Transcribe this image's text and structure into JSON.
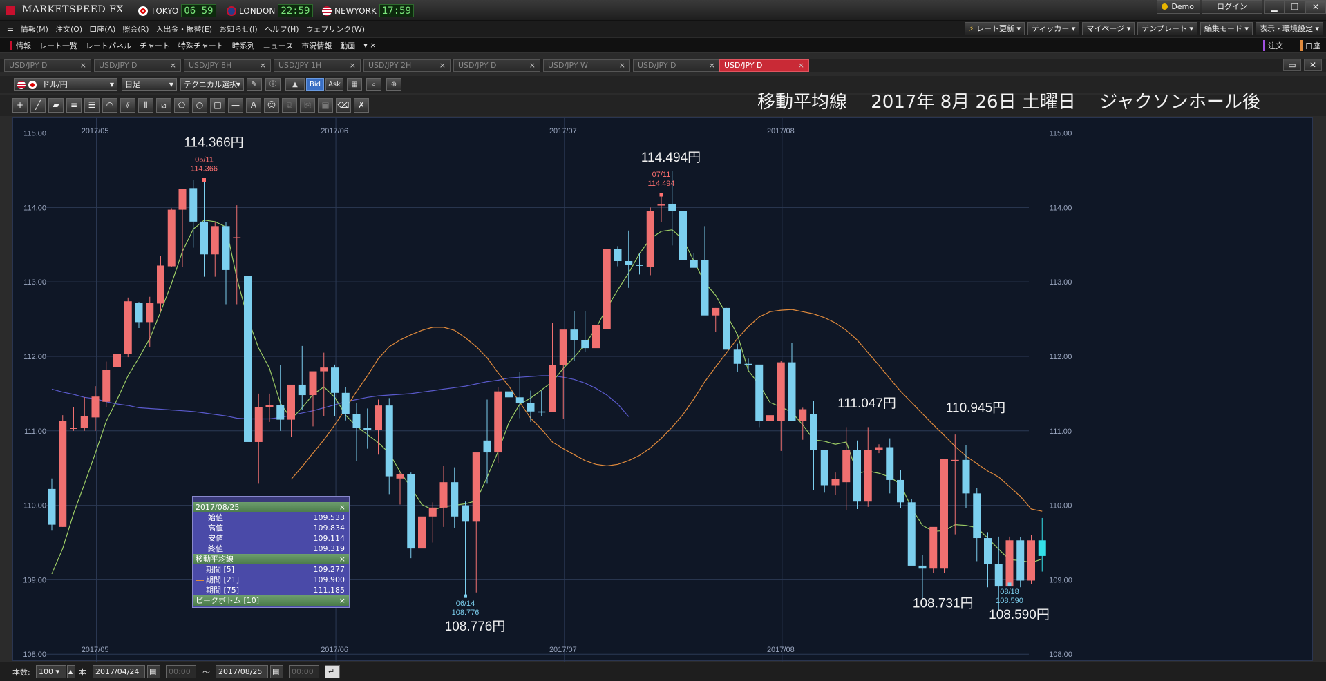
{
  "app": {
    "title": "MARKETSPEED FX",
    "clocks": [
      {
        "city": "TOKYO",
        "time": "06 59",
        "flag": "jp-flag-icon"
      },
      {
        "city": "LONDON",
        "time": "22:59",
        "flag": "uk-flag-icon"
      },
      {
        "city": "NEWYORK",
        "time": "17:59",
        "flag": "us-flag-icon"
      }
    ],
    "demo_label": "Demo",
    "login_label": "ログイン"
  },
  "menu": {
    "items": [
      "情報(M)",
      "注文(O)",
      "口座(A)",
      "照会(R)",
      "入出金・振替(E)",
      "お知らせ(I)",
      "ヘルプ(H)",
      "ウェブリンク(W)"
    ],
    "right_tools": [
      "レート更新",
      "ティッカー",
      "マイページ",
      "テンプレート",
      "編集モード",
      "表示・環境設定"
    ]
  },
  "subbar": {
    "items": [
      "情報",
      "レート一覧",
      "レートパネル",
      "チャート",
      "特殊チャート",
      "時系列",
      "ニュース",
      "市況情報",
      "動画"
    ],
    "order_label": "注文",
    "account_label": "口座"
  },
  "tabs": [
    "USD/JPY D",
    "USD/JPY D",
    "USD/JPY 8H",
    "USD/JPY 1H",
    "USD/JPY 2H",
    "USD/JPY D",
    "USD/JPY W",
    "USD/JPY D",
    "USD/JPY D"
  ],
  "active_tab": 8,
  "toolbar": {
    "pair": "ドル/円",
    "period": "日足",
    "technical": "テクニカル選択",
    "bid": "Bid",
    "ask": "Ask"
  },
  "heading": "移動平均線　 2017年 8月 26日 土曜日　 ジャクソンホール後",
  "popup": {
    "date": "2017/08/25",
    "rows": [
      {
        "label": "始値",
        "value": "109.533"
      },
      {
        "label": "高値",
        "value": "109.834"
      },
      {
        "label": "安値",
        "value": "109.114"
      },
      {
        "label": "終値",
        "value": "109.319"
      }
    ],
    "ma_title": "移動平均線",
    "ma_rows": [
      {
        "label": "期間 [5]",
        "value": "109.277",
        "color": "#9ccc65"
      },
      {
        "label": "期間 [21]",
        "value": "109.900",
        "color": "#e08a3c"
      },
      {
        "label": "期間 [75]",
        "value": "111.185",
        "color": "#5a5acc"
      }
    ],
    "peak_title": "ピークボトム [10]",
    "close_glyph": "×"
  },
  "bottom": {
    "count_label": "本数:",
    "count": "100",
    "unit": "本",
    "from_date": "2017/04/24",
    "from_time": "00:00",
    "tilde": "〜",
    "to_date": "2017/08/25",
    "to_time": "00:00"
  },
  "annotations": [
    {
      "text": "114.366円",
      "i": 14,
      "pos": "above"
    },
    {
      "text": "114.494円",
      "i": 56,
      "pos": "above"
    },
    {
      "text": "108.776円",
      "i": 38,
      "pos": "below"
    },
    {
      "text": "111.047円",
      "i": 74,
      "pos": "above"
    },
    {
      "text": "110.945円",
      "i": 84,
      "pos": "above"
    },
    {
      "text": "108.731円",
      "i": 81,
      "pos": "below"
    },
    {
      "text": "108.590円",
      "i": 88,
      "pos": "below"
    }
  ],
  "peaks": [
    {
      "i": 14,
      "date": "05/11",
      "value": "114.366",
      "type": "high"
    },
    {
      "i": 56,
      "date": "07/11",
      "value": "114.494",
      "type": "high"
    },
    {
      "i": 38,
      "date": "06/14",
      "value": "108.776",
      "type": "low"
    },
    {
      "i": 88,
      "date": "08/18",
      "value": "108.590",
      "type": "low"
    }
  ],
  "chart_data": {
    "type": "candlestick",
    "y_range": [
      107.9,
      115.2
    ],
    "y_ticks": [
      "115.00",
      "114.00",
      "113.00",
      "112.00",
      "111.00",
      "110.00",
      "109.00",
      "108.00"
    ],
    "x_labels": [
      {
        "label": "2017/05",
        "i": 5
      },
      {
        "label": "2017/06",
        "i": 27
      },
      {
        "label": "2017/07",
        "i": 48
      },
      {
        "label": "2017/08",
        "i": 68
      }
    ],
    "colors": {
      "up": "#f07070",
      "down": "#7ccfee",
      "ma5": "#9ccc65",
      "ma21": "#e08a3c",
      "ma75": "#5a5acc",
      "last": "#33e0e8"
    },
    "candles": [
      [
        110.22,
        110.36,
        109.66,
        109.74
      ],
      [
        109.71,
        111.21,
        109.71,
        111.13
      ],
      [
        111.04,
        111.32,
        111.0,
        111.04
      ],
      [
        111.04,
        111.45,
        111.0,
        111.2
      ],
      [
        111.18,
        111.6,
        111.0,
        111.46
      ],
      [
        111.39,
        111.93,
        111.32,
        111.82
      ],
      [
        111.86,
        112.22,
        111.78,
        112.03
      ],
      [
        112.03,
        112.79,
        111.99,
        112.74
      ],
      [
        112.72,
        112.73,
        112.38,
        112.46
      ],
      [
        112.46,
        112.8,
        112.13,
        112.72
      ],
      [
        112.71,
        113.35,
        112.6,
        113.22
      ],
      [
        113.21,
        113.99,
        113.2,
        113.97
      ],
      [
        113.97,
        114.02,
        113.2,
        114.25
      ],
      [
        114.26,
        114.37,
        113.46,
        113.81
      ],
      [
        113.81,
        114.37,
        113.07,
        113.37
      ],
      [
        113.37,
        113.8,
        113.07,
        113.75
      ],
      [
        113.75,
        113.8,
        112.7,
        113.16
      ],
      [
        113.6,
        114.03,
        112.7,
        113.6
      ],
      [
        113.08,
        113.08,
        110.95,
        110.85
      ],
      [
        110.85,
        111.5,
        110.29,
        111.32
      ],
      [
        111.32,
        111.5,
        111.12,
        111.35
      ],
      [
        111.35,
        111.88,
        111.0,
        111.15
      ],
      [
        111.15,
        111.59,
        110.92,
        111.62
      ],
      [
        111.62,
        112.14,
        111.28,
        111.48
      ],
      [
        111.48,
        111.77,
        111.06,
        111.8
      ],
      [
        111.8,
        112.05,
        111.2,
        111.85
      ],
      [
        111.85,
        111.89,
        111.2,
        111.51
      ],
      [
        111.51,
        111.59,
        111.14,
        111.23
      ],
      [
        111.23,
        111.37,
        110.59,
        111.04
      ],
      [
        111.04,
        111.3,
        110.76,
        111.01
      ],
      [
        111.01,
        111.42,
        110.68,
        111.34
      ],
      [
        111.34,
        111.44,
        110.15,
        110.39
      ],
      [
        110.36,
        110.44,
        110.01,
        110.42
      ],
      [
        110.42,
        110.44,
        109.29,
        109.42
      ],
      [
        109.42,
        110.01,
        109.2,
        109.85
      ],
      [
        109.85,
        110.04,
        109.5,
        109.97
      ],
      [
        109.97,
        110.53,
        109.71,
        110.31
      ],
      [
        110.31,
        110.51,
        109.7,
        109.85
      ],
      [
        110.0,
        110.05,
        108.78,
        109.78
      ],
      [
        109.78,
        110.24,
        108.83,
        110.71
      ],
      [
        110.87,
        111.42,
        110.29,
        110.71
      ],
      [
        110.71,
        111.59,
        110.57,
        111.53
      ],
      [
        111.53,
        111.79,
        111.38,
        111.45
      ],
      [
        111.45,
        111.79,
        111.17,
        111.37
      ],
      [
        111.37,
        111.54,
        111.12,
        111.26
      ],
      [
        111.26,
        111.54,
        111.2,
        111.25
      ],
      [
        111.25,
        112.45,
        111.25,
        111.88
      ],
      [
        111.88,
        112.31,
        111.16,
        112.36
      ],
      [
        112.36,
        112.61,
        111.94,
        112.22
      ],
      [
        112.22,
        112.61,
        112.06,
        112.11
      ],
      [
        112.11,
        112.5,
        111.8,
        112.42
      ],
      [
        112.37,
        113.44,
        112.37,
        113.44
      ],
      [
        113.44,
        113.48,
        113.21,
        113.28
      ],
      [
        113.28,
        113.69,
        112.92,
        113.23
      ],
      [
        113.23,
        113.39,
        113.1,
        113.22
      ],
      [
        113.2,
        114.0,
        113.09,
        113.95
      ],
      [
        114.04,
        114.17,
        113.8,
        114.04
      ],
      [
        114.05,
        114.49,
        113.49,
        113.95
      ],
      [
        113.95,
        114.08,
        112.79,
        113.29
      ],
      [
        113.29,
        113.39,
        113.23,
        113.19
      ],
      [
        113.29,
        113.75,
        113.09,
        112.55
      ],
      [
        112.55,
        112.65,
        112.33,
        112.65
      ],
      [
        112.65,
        112.65,
        112.12,
        112.09
      ],
      [
        112.09,
        112.17,
        111.79,
        111.9
      ],
      [
        111.9,
        111.97,
        111.82,
        111.89
      ],
      [
        111.89,
        111.8,
        111.05,
        111.13
      ],
      [
        111.13,
        111.61,
        110.82,
        111.21
      ],
      [
        111.13,
        111.94,
        110.73,
        111.92
      ],
      [
        111.92,
        112.18,
        111.2,
        111.13
      ],
      [
        111.13,
        111.31,
        110.88,
        111.29
      ],
      [
        111.23,
        111.4,
        110.21,
        110.74
      ],
      [
        110.74,
        110.71,
        110.17,
        110.27
      ],
      [
        110.27,
        110.44,
        110.14,
        110.35
      ],
      [
        110.31,
        111.05,
        109.94,
        110.74
      ],
      [
        110.74,
        110.87,
        109.95,
        110.05
      ],
      [
        110.05,
        111.05,
        109.98,
        110.74
      ],
      [
        110.74,
        110.82,
        110.7,
        110.78
      ],
      [
        110.78,
        110.9,
        110.16,
        110.34
      ],
      [
        110.34,
        110.47,
        109.96,
        110.04
      ],
      [
        110.04,
        110.08,
        109.56,
        109.19
      ],
      [
        109.19,
        109.33,
        108.73,
        109.15
      ],
      [
        109.15,
        109.47,
        109.09,
        109.71
      ],
      [
        109.15,
        109.76,
        109.09,
        110.62
      ],
      [
        110.61,
        110.95,
        109.61,
        110.61
      ],
      [
        110.61,
        110.81,
        109.96,
        110.16
      ],
      [
        110.16,
        110.23,
        109.25,
        109.56
      ],
      [
        109.56,
        109.64,
        108.9,
        109.21
      ],
      [
        109.21,
        109.58,
        108.59,
        108.91
      ],
      [
        108.91,
        109.58,
        108.94,
        109.53
      ],
      [
        109.53,
        109.57,
        108.9,
        108.99
      ],
      [
        108.99,
        109.6,
        108.94,
        109.53
      ],
      [
        109.53,
        109.83,
        109.11,
        109.32
      ]
    ],
    "ma5": [
      109.08,
      109.42,
      109.89,
      110.29,
      110.7,
      111.13,
      111.42,
      111.74,
      111.98,
      112.24,
      112.6,
      112.98,
      113.41,
      113.71,
      113.83,
      113.81,
      113.74,
      113.05,
      112.51,
      112.11,
      111.84,
      111.37,
      111.16,
      111.31,
      111.49,
      111.59,
      111.45,
      111.21,
      111.06,
      110.95,
      110.84,
      110.7,
      110.45,
      110.24,
      110.01,
      109.94,
      109.98,
      110.0,
      110.02,
      110.06,
      110.38,
      110.72,
      111.11,
      111.36,
      111.44,
      111.55,
      111.66,
      111.84,
      111.99,
      112.16,
      112.38,
      112.65,
      112.89,
      113.12,
      113.38,
      113.58,
      113.68,
      113.7,
      113.57,
      113.28,
      112.99,
      112.82,
      112.56,
      112.29,
      111.81,
      111.62,
      111.38,
      111.32,
      111.25,
      111.08,
      110.88,
      110.86,
      110.82,
      110.85,
      110.43,
      110.46,
      110.43,
      110.38,
      110.28,
      109.96,
      109.73,
      109.65,
      109.66,
      109.74,
      109.73,
      109.7,
      109.56,
      109.41,
      109.27,
      109.26,
      109.23,
      109.28
    ],
    "ma21": [
      null,
      null,
      null,
      null,
      null,
      null,
      null,
      110.35,
      110.52,
      110.7,
      110.88,
      111.08,
      111.3,
      111.53,
      111.74,
      111.97,
      112.13,
      112.22,
      112.29,
      112.35,
      112.39,
      112.39,
      112.35,
      112.25,
      112.13,
      111.98,
      111.78,
      111.6,
      111.38,
      111.17,
      111.02,
      110.85,
      110.76,
      110.68,
      110.6,
      110.55,
      110.53,
      110.55,
      110.6,
      110.67,
      110.77,
      110.9,
      111.05,
      111.22,
      111.43,
      111.66,
      111.86,
      112.05,
      112.24,
      112.4,
      112.53,
      112.6,
      112.62,
      112.63,
      112.6,
      112.57,
      112.52,
      112.45,
      112.35,
      112.22,
      112.05,
      111.88,
      111.7,
      111.53,
      111.38,
      111.23,
      111.08,
      110.94,
      110.79,
      110.66,
      110.56,
      110.46,
      110.38,
      110.25,
      110.12,
      109.95,
      109.92
    ],
    "ma75": [
      111.56,
      111.52,
      111.49,
      111.45,
      111.43,
      111.39,
      111.36,
      111.34,
      111.31,
      111.3,
      111.29,
      111.28,
      111.27,
      111.26,
      111.24,
      111.22,
      111.2,
      111.17,
      111.16,
      111.16,
      111.16,
      111.18,
      111.21,
      111.24,
      111.27,
      111.31,
      111.35,
      111.39,
      111.42,
      111.45,
      111.47,
      111.48,
      111.49,
      111.5,
      111.52,
      111.54,
      111.56,
      111.58,
      111.6,
      111.63,
      111.66,
      111.68,
      111.71,
      111.72,
      111.73,
      111.74,
      111.74,
      111.72,
      111.69,
      111.64,
      111.57,
      111.48,
      111.36,
      111.19
    ]
  }
}
